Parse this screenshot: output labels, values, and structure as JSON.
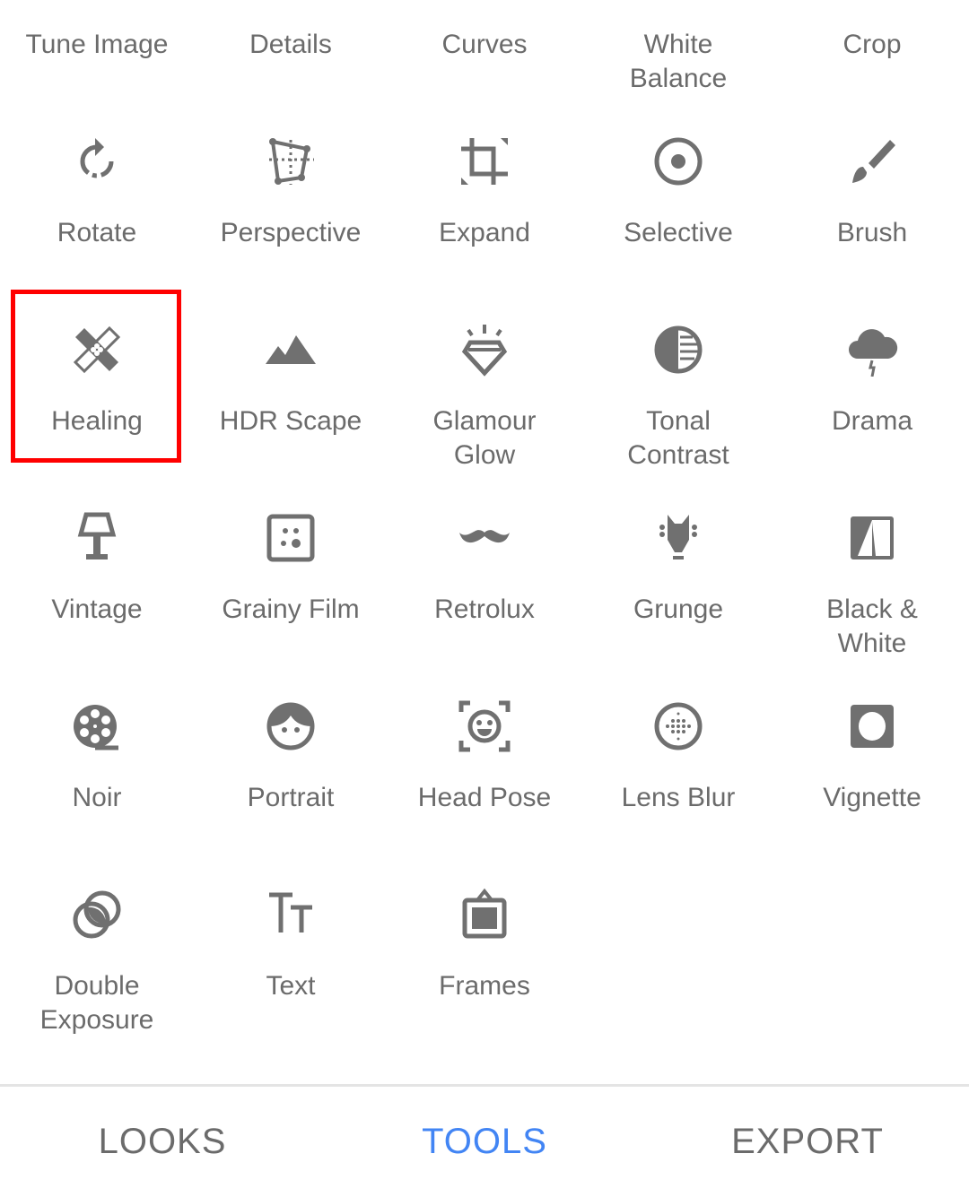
{
  "colors": {
    "icon": "#707070",
    "label": "#6b6b6b",
    "active_tab": "#4285f4",
    "highlight": "#ff0000"
  },
  "tools": [
    {
      "label": "Tune Image",
      "icon": "none"
    },
    {
      "label": "Details",
      "icon": "none"
    },
    {
      "label": "Curves",
      "icon": "none"
    },
    {
      "label": "White\nBalance",
      "icon": "none"
    },
    {
      "label": "Crop",
      "icon": "none"
    },
    {
      "label": "Rotate",
      "icon": "rotate-icon"
    },
    {
      "label": "Perspective",
      "icon": "perspective-icon"
    },
    {
      "label": "Expand",
      "icon": "expand-icon"
    },
    {
      "label": "Selective",
      "icon": "selective-icon"
    },
    {
      "label": "Brush",
      "icon": "brush-icon"
    },
    {
      "label": "Healing",
      "icon": "healing-bandage-icon",
      "highlighted": true
    },
    {
      "label": "HDR Scape",
      "icon": "mountains-icon"
    },
    {
      "label": "Glamour\nGlow",
      "icon": "diamond-icon"
    },
    {
      "label": "Tonal\nContrast",
      "icon": "tonal-contrast-icon"
    },
    {
      "label": "Drama",
      "icon": "storm-cloud-icon"
    },
    {
      "label": "Vintage",
      "icon": "lamp-icon"
    },
    {
      "label": "Grainy Film",
      "icon": "grainy-film-icon"
    },
    {
      "label": "Retrolux",
      "icon": "mustache-icon"
    },
    {
      "label": "Grunge",
      "icon": "guitar-head-icon"
    },
    {
      "label": "Black &\nWhite",
      "icon": "black-white-icon"
    },
    {
      "label": "Noir",
      "icon": "film-reel-icon"
    },
    {
      "label": "Portrait",
      "icon": "face-icon"
    },
    {
      "label": "Head Pose",
      "icon": "head-pose-icon"
    },
    {
      "label": "Lens Blur",
      "icon": "lens-blur-icon"
    },
    {
      "label": "Vignette",
      "icon": "vignette-icon"
    },
    {
      "label": "Double\nExposure",
      "icon": "double-exposure-icon"
    },
    {
      "label": "Text",
      "icon": "text-icon"
    },
    {
      "label": "Frames",
      "icon": "frames-icon"
    }
  ],
  "nav": {
    "looks": "LOOKS",
    "tools": "TOOLS",
    "export": "EXPORT",
    "active": "tools"
  }
}
